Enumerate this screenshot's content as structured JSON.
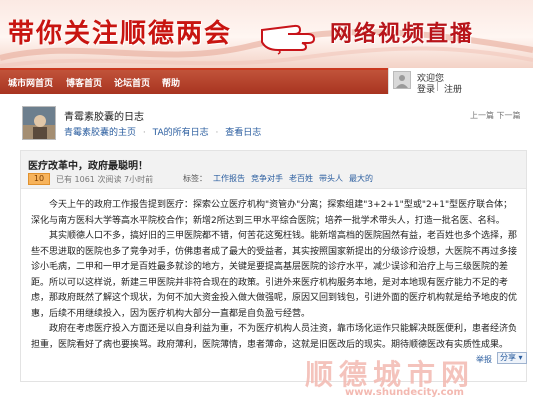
{
  "banner": {
    "left_text": "带你关注顺德两会",
    "right_text": "网络视频直播",
    "colors": {
      "primary": "#c81410",
      "nav": "#b03a24"
    }
  },
  "nav": {
    "items": [
      {
        "label": "城市网首页"
      },
      {
        "label": "博客首页"
      },
      {
        "label": "论坛首页"
      },
      {
        "label": "帮助"
      }
    ]
  },
  "user": {
    "welcome": "欢迎您",
    "login": "登录",
    "separator": "|",
    "register": "注册"
  },
  "blog": {
    "title": "青霉素胶囊的日志",
    "links": [
      {
        "label": "青霉素胶囊的主页"
      },
      {
        "label": "TA的所有日志"
      },
      {
        "label": "查看日志"
      }
    ],
    "manage": "上一篇 下一篇"
  },
  "post": {
    "title": "医疗改革中，政府最聪明！",
    "score": "10",
    "meta": "已有 1061 次阅读  7小时前",
    "tags_label": "标签：",
    "tags": [
      "工作报告",
      "竞争对手",
      "老百姓",
      "带头人",
      "最大的"
    ],
    "paragraphs": [
      "今天上午的政府工作报告提到医疗：探索公立医疗机构\"资管办\"分离；探索组建\"3+2+1\"型或\"2+1\"型医疗联合体；深化与南方医科大学等高水平院校合作；新增2所达到三甲水平综合医院；培养一批学术带头人，打造一批名医、名科。",
      "其实顺德人口不多，搞好旧的三甲医院都不错，何苦花这冤枉钱。能新增高档的医院固然有益，老百姓也多个选择，那些不思进取的医院也多了竞争对手，仿佛患者成了最大的受益者，其实按照国家新提出的分级诊疗设想，大医院不再过多接诊小毛病，二甲和一甲才是百姓最多就诊的地方，关键是要提高基层医院的诊疗水平，减少误诊和治疗上与三级医院的差距。所以可以这样说，新建三甲医院并非符合现在的政策。引进外来医疗机构服务本地，是对本地现有医疗能力不足的考虑，那政府既然了解这个现状，为何不加大资金投入做大做强呢，原因又回到钱包，引进外面的医疗机构就是给予地皮的优惠，后续不用继续投入，因为医疗机构大部分一直都是自负盈亏经营。",
      "政府在考虑医疗投入方面还是以自身利益为重，不为医疗机构人员注资，靠市场化运作只能解决既医便利，患者经济负担重，医院看好了病也要挨骂。政府薄利，医院薄情，患者薄命，这就是旧医改后的现实。期待顺德医改有实质性成果。"
    ],
    "watermark": "顺德城市网",
    "watermark_url": "www.shundecity.com",
    "report": "举报",
    "share": "分享"
  }
}
